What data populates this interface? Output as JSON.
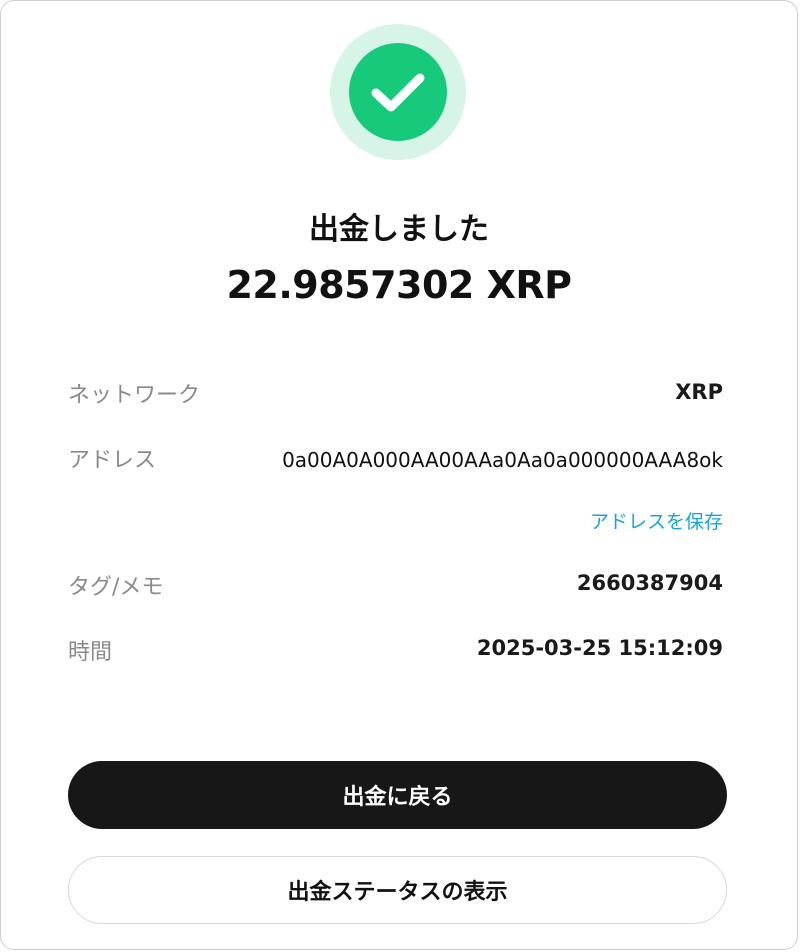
{
  "header": {
    "status_icon": "check-circle-icon",
    "title": "出金しました",
    "amount": "22.9857302 XRP"
  },
  "details": {
    "network": {
      "label": "ネットワーク",
      "value": "XRP"
    },
    "address": {
      "label": "アドレス",
      "value": "0a00A0A000AA00AAa0Aa0a000000AAA8ok",
      "save_link": "アドレスを保存"
    },
    "tag": {
      "label": "タグ/メモ",
      "value": "2660387904"
    },
    "time": {
      "label": "時間",
      "value": "2025-03-25 15:12:09"
    }
  },
  "actions": {
    "back_label": "出金に戻る",
    "status_label": "出金ステータスの表示"
  },
  "colors": {
    "success": "#17c97b",
    "success_ring": "#d6f5e6",
    "link": "#18a5d6",
    "primary_button": "#171717"
  }
}
